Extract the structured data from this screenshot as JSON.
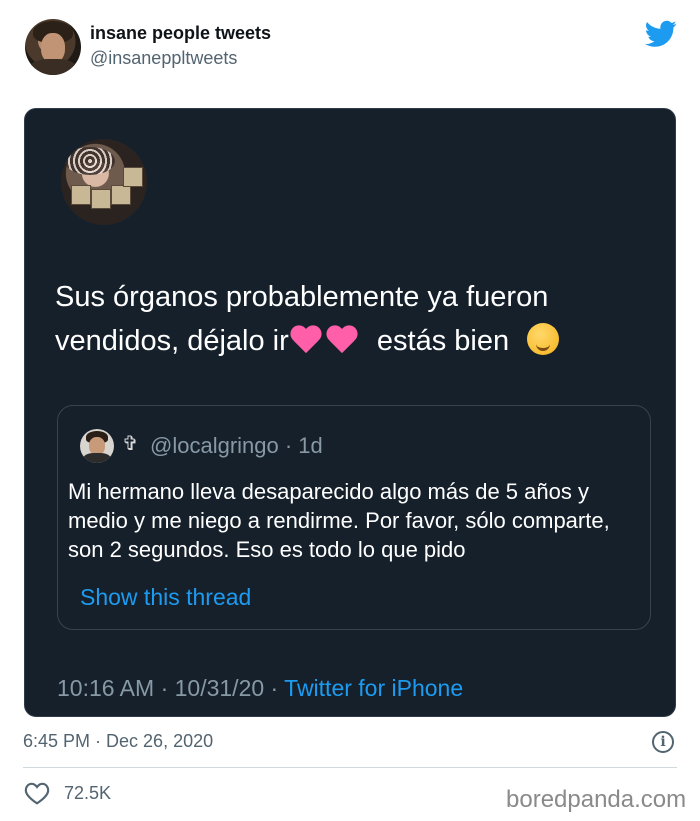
{
  "author": {
    "name": "insane people tweets",
    "handle": "@insanepp​ltweets"
  },
  "tweet": {
    "text_line1": "Sus órganos probablemente ya fueron",
    "text_line2_start": "vendidos, déjalo ir",
    "text_line2_end": "estás bien",
    "quote": {
      "handle": "@localgringo · 1d",
      "text": "Mi hermano lleva desaparecido algo más de 5 años y medio y me niego a rendirme. Por favor, sólo comparte, son 2 segundos. Eso es todo lo que pido",
      "show_thread": "Show this thread"
    },
    "meta_time": "10:16 AM · 10/31/20 · ",
    "meta_source": "Twitter for iPhone"
  },
  "post": {
    "timestamp": "6:45 PM · Dec 26, 2020",
    "likes": "72.5K"
  },
  "watermark": "boredpanda.com",
  "colors": {
    "card_bg": "#15202b",
    "link_blue": "#1d9bf0",
    "twitter_blue": "#1d9bf0"
  },
  "icons": [
    "twitter-bird-icon",
    "heart-emoji-icon",
    "drooling-face-emoji-icon",
    "cross-icon",
    "info-icon",
    "like-heart-icon"
  ]
}
